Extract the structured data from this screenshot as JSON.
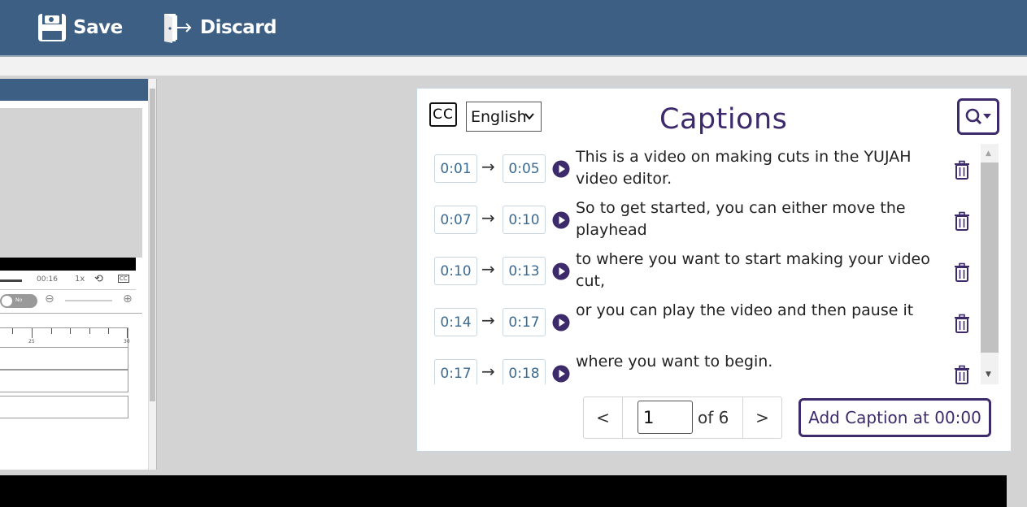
{
  "toolbar": {
    "save_label": "Save",
    "discard_label": "Discard",
    "save_icon": "floppy-disk-icon",
    "discard_icon": "door-exit-icon"
  },
  "preview": {
    "current_time": "00:16",
    "speed": "1x",
    "cc_label": "CC",
    "toggle_label": "No",
    "ruler_labels": [
      "25",
      "30"
    ]
  },
  "captions": {
    "cc_label": "CC",
    "language": "English",
    "title": "Captions",
    "search_icon": "search-dropdown-icon",
    "items": [
      {
        "start": "0:01",
        "end": "0:05",
        "text": "This is a video on making cuts in the YUJAH video editor."
      },
      {
        "start": "0:07",
        "end": "0:10",
        "text": "So to get started, you can either move the playhead"
      },
      {
        "start": "0:10",
        "end": "0:13",
        "text": "to where you want to start making your video cut,"
      },
      {
        "start": "0:14",
        "end": "0:17",
        "text": "or you can play the video and then pause it"
      },
      {
        "start": "0:17",
        "end": "0:18",
        "text": "where you want to begin."
      }
    ],
    "arrow": "→",
    "pagination": {
      "prev": "<",
      "next": ">",
      "current_page": "1",
      "of_text": "of 6"
    },
    "add_button": "Add Caption at 00:00"
  },
  "colors": {
    "toolbar_bg": "#3c5f83",
    "accent_purple": "#3d2a6b",
    "time_text": "#3b6a93"
  }
}
